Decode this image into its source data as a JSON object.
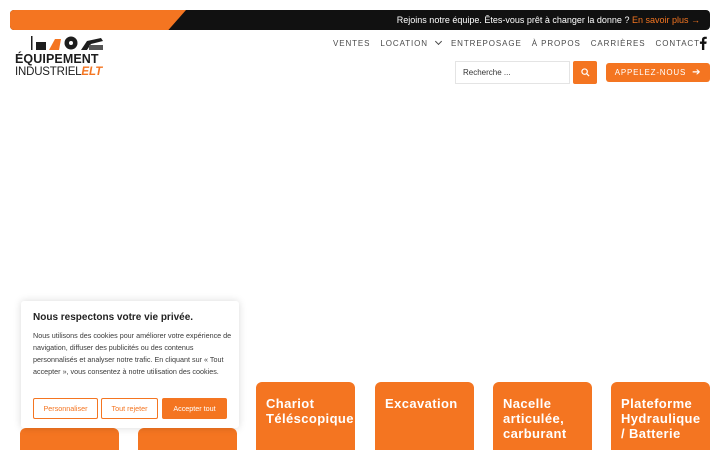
{
  "topbar": {
    "text": "Rejoins notre équipe. Êtes-vous prêt à changer la donne ?",
    "link": "En savoir plus →"
  },
  "logo": {
    "line1": "ÉQUIPEMENT",
    "line2_a": "INDUSTRIEL",
    "line2_b": "ELT"
  },
  "nav": {
    "items": [
      "Ventes",
      "Location",
      "Entreposage",
      "À propos",
      "Carrières",
      "Contact"
    ]
  },
  "search": {
    "placeholder": "Recherche ..."
  },
  "call_button": {
    "label": "Appelez-nous"
  },
  "cards": [
    {
      "title": ""
    },
    {
      "title": ""
    },
    {
      "title": "Chariot Téléscopique"
    },
    {
      "title": "Excavation"
    },
    {
      "title": "Nacelle articulée, carburant"
    },
    {
      "title": "Plateforme Hydraulique / Batterie"
    }
  ],
  "cookie": {
    "title": "Nous respectons votre vie privée.",
    "text": "Nous utilisons des cookies pour améliorer votre expérience de navigation, diffuser des publicités ou des contenus personnalisés et analyser notre trafic. En cliquant sur « Tout accepter », vous consentez à notre utilisation des cookies.",
    "customize": "Personnaliser",
    "reject": "Tout rejeter",
    "accept": "Accepter tout"
  },
  "colors": {
    "brand_orange": "#f47521",
    "topbar_bg": "#111111"
  },
  "icons": [
    "search-icon",
    "facebook-icon",
    "chevron-down-icon",
    "arrow-right-icon"
  ]
}
